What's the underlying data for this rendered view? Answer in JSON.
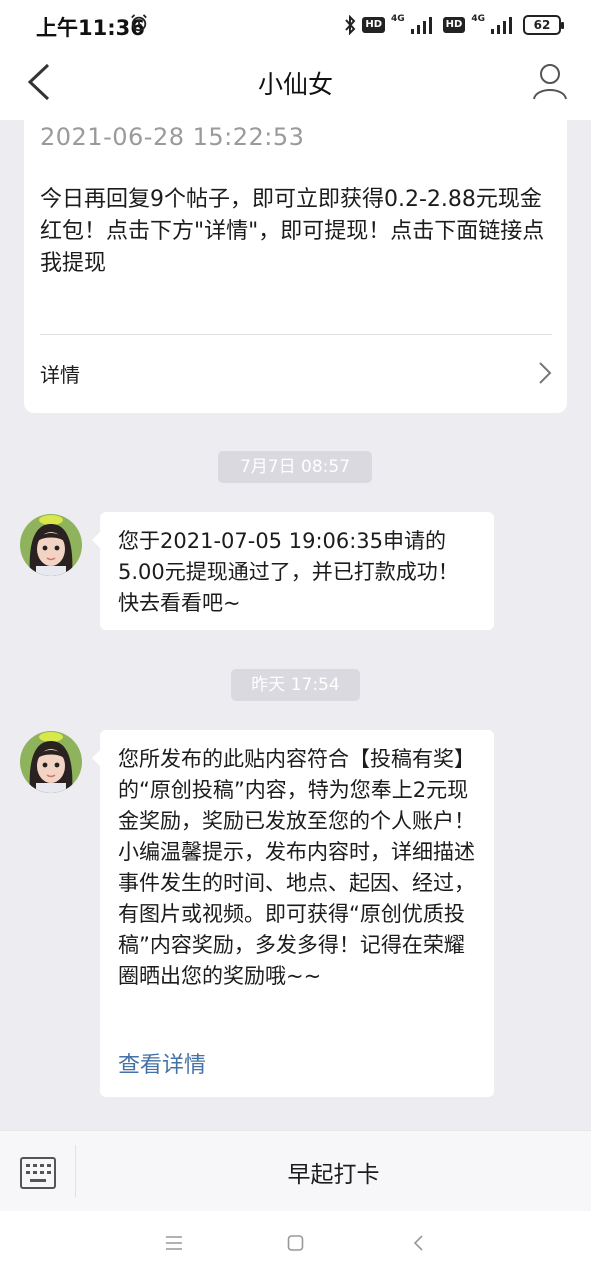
{
  "status_bar": {
    "time": "上午11:36",
    "hd_label": "HD",
    "network_label": "4G",
    "battery": "62",
    "icons": [
      "alarm-icon",
      "bluetooth-icon",
      "signal-icon",
      "battery-icon"
    ]
  },
  "nav": {
    "title": "小仙女",
    "icons": [
      "back-icon",
      "profile-icon"
    ]
  },
  "card": {
    "timestamp": "2021-06-28 15:22:53",
    "body": "今日再回复9个帖子，即可立即获得0.2-2.88元现金红包！点击下方\"详情\"，即可提现！点击下面链接点我提现",
    "detail_label": "详情"
  },
  "messages": [
    {
      "time": "7月7日 08:57",
      "text": "您于2021-07-05 19:06:35申请的5.00元提现通过了，并已打款成功！快去看看吧~"
    },
    {
      "time": "昨天 17:54",
      "text": "您所发布的此贴内容符合【投稿有奖】的“原创投稿”内容，特为您奉上2元现金奖励，奖励已发放至您的个人账户！小编温馨提示，发布内容时，详细描述事件发生的时间、地点、起因、经过，有图片或视频。即可获得“原创优质投稿”内容奖励，多发多得！记得在荣耀圈晒出您的奖励哦~~",
      "link": "查看详情"
    }
  ],
  "bottom_bar": {
    "menu_label": "早起打卡",
    "icon": "keyboard-icon"
  },
  "system_nav": {
    "icons": [
      "menu-icon",
      "home-icon",
      "back-nav-icon"
    ]
  },
  "colors": {
    "background": "#ededf1",
    "link": "#4472a6",
    "time_pill": "#d9d9df"
  }
}
